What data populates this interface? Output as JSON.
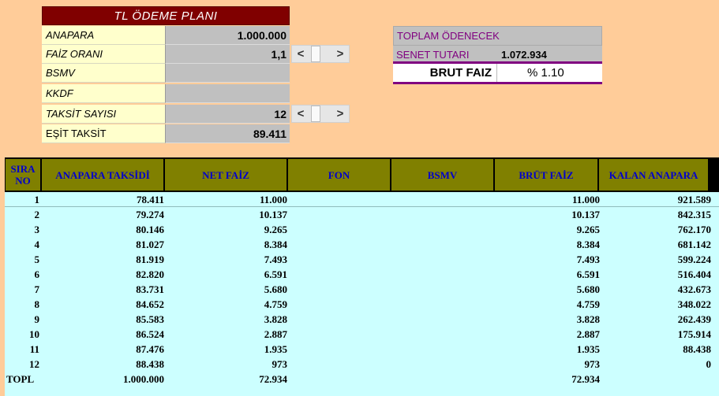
{
  "plan": {
    "title": "TL ÖDEME PLANI",
    "rows": [
      {
        "label": "ANAPARA",
        "value": "1.000.000"
      },
      {
        "label": "FAİZ ORANI",
        "value": "1,1"
      },
      {
        "label": "BSMV",
        "value": ""
      },
      {
        "label": "KKDF",
        "value": ""
      },
      {
        "label": "TAKSİT SAYISI",
        "value": "12"
      },
      {
        "label": "EŞİT TAKSİT",
        "value": "89.411"
      }
    ],
    "spinner_left": "<",
    "spinner_right": ">"
  },
  "summary": {
    "total_label": "TOPLAM ÖDENECEK",
    "senet_label": "SENET TUTARI",
    "senet_value": "1.072.934",
    "brut_label": "BRUT FAIZ",
    "brut_value": "% 1.10"
  },
  "table": {
    "headers": [
      "SIRA NO",
      "ANAPARA TAKSİDİ",
      "NET FAİZ",
      "FON",
      "BSMV",
      "BRÜT FAİZ",
      "KALAN ANAPARA"
    ],
    "rows": [
      {
        "no": "1",
        "ana": "78.411",
        "net": "11.000",
        "fon": "",
        "bsmv": "",
        "brut": "11.000",
        "kal": "921.589"
      },
      {
        "no": "2",
        "ana": "79.274",
        "net": "10.137",
        "fon": "",
        "bsmv": "",
        "brut": "10.137",
        "kal": "842.315"
      },
      {
        "no": "3",
        "ana": "80.146",
        "net": "9.265",
        "fon": "",
        "bsmv": "",
        "brut": "9.265",
        "kal": "762.170"
      },
      {
        "no": "4",
        "ana": "81.027",
        "net": "8.384",
        "fon": "",
        "bsmv": "",
        "brut": "8.384",
        "kal": "681.142"
      },
      {
        "no": "5",
        "ana": "81.919",
        "net": "7.493",
        "fon": "",
        "bsmv": "",
        "brut": "7.493",
        "kal": "599.224"
      },
      {
        "no": "6",
        "ana": "82.820",
        "net": "6.591",
        "fon": "",
        "bsmv": "",
        "brut": "6.591",
        "kal": "516.404"
      },
      {
        "no": "7",
        "ana": "83.731",
        "net": "5.680",
        "fon": "",
        "bsmv": "",
        "brut": "5.680",
        "kal": "432.673"
      },
      {
        "no": "8",
        "ana": "84.652",
        "net": "4.759",
        "fon": "",
        "bsmv": "",
        "brut": "4.759",
        "kal": "348.022"
      },
      {
        "no": "9",
        "ana": "85.583",
        "net": "3.828",
        "fon": "",
        "bsmv": "",
        "brut": "3.828",
        "kal": "262.439"
      },
      {
        "no": "10",
        "ana": "86.524",
        "net": "2.887",
        "fon": "",
        "bsmv": "",
        "brut": "2.887",
        "kal": "175.914"
      },
      {
        "no": "11",
        "ana": "87.476",
        "net": "1.935",
        "fon": "",
        "bsmv": "",
        "brut": "1.935",
        "kal": "88.438"
      },
      {
        "no": "12",
        "ana": "88.438",
        "net": "973",
        "fon": "",
        "bsmv": "",
        "brut": "973",
        "kal": "0"
      }
    ],
    "total": {
      "no": "TOPL",
      "ana": "1.000.000",
      "net": "72.934",
      "fon": "",
      "bsmv": "",
      "brut": "72.934",
      "kal": ""
    }
  }
}
